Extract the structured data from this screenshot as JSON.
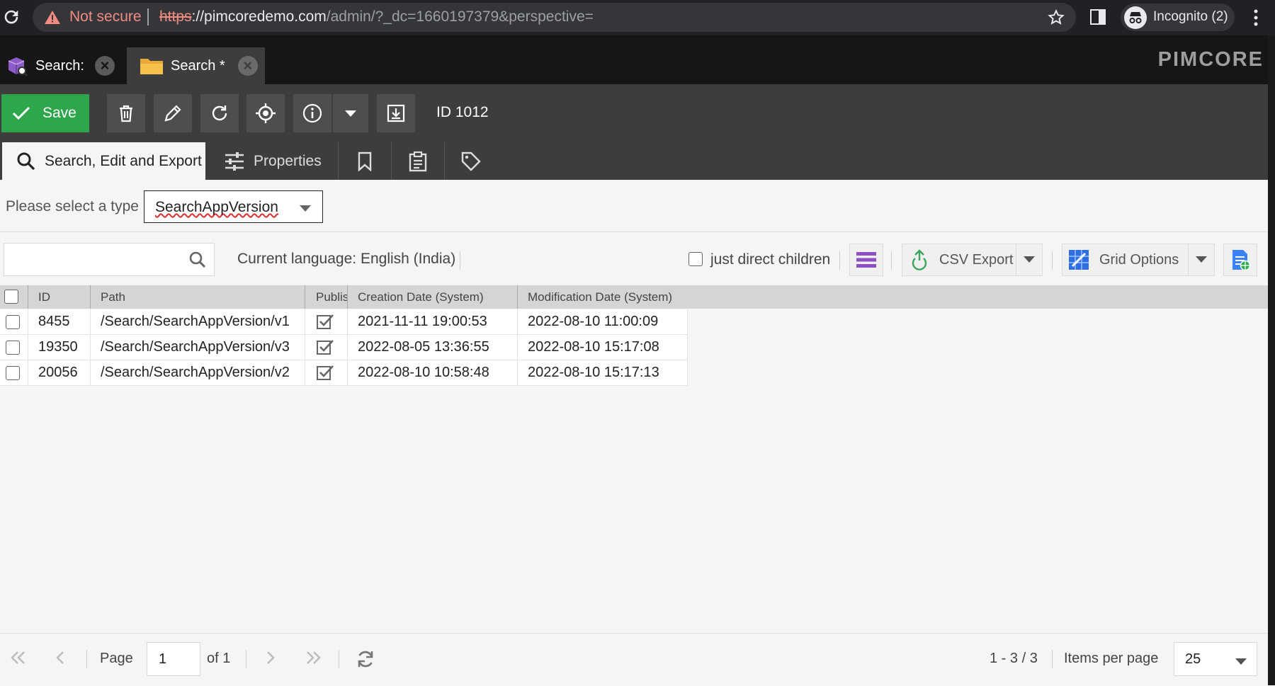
{
  "browser": {
    "not_secure": "Not secure",
    "url_scheme": "https",
    "url_host": "://pimcoredemo.com",
    "url_path": "/admin/?_dc=1660197379&perspective=",
    "incognito": "Incognito (2)"
  },
  "app": {
    "tabs": [
      {
        "label": "Search:"
      },
      {
        "label": "Search *"
      }
    ],
    "brand": "PIMCORE"
  },
  "toolbar": {
    "save_label": "Save",
    "id_label": "ID 1012"
  },
  "subtabs": {
    "search": "Search, Edit and Export",
    "properties": "Properties"
  },
  "type_select": {
    "label": "Please select a type",
    "value": "SearchAppVersion"
  },
  "grid_toolbar": {
    "search_placeholder": "",
    "language": "Current language: English (India)",
    "direct_children": "just direct children",
    "csv_export": "CSV Export",
    "grid_options": "Grid Options"
  },
  "grid": {
    "columns": [
      "ID",
      "Path",
      "Publis",
      "Creation Date (System)",
      "Modification Date (System)"
    ],
    "rows": [
      {
        "id": "8455",
        "path": "/Search/SearchAppVersion/v1",
        "created": "2021-11-11 19:00:53",
        "modified": "2022-08-10 11:00:09"
      },
      {
        "id": "19350",
        "path": "/Search/SearchAppVersion/v3",
        "created": "2022-08-05 13:36:55",
        "modified": "2022-08-10 15:17:08"
      },
      {
        "id": "20056",
        "path": "/Search/SearchAppVersion/v2",
        "created": "2022-08-10 10:58:48",
        "modified": "2022-08-10 15:17:13"
      }
    ]
  },
  "pager": {
    "page_label": "Page",
    "page_value": "1",
    "of_label": "of 1",
    "range": "1 - 3 / 3",
    "items_per_page": "Items per page",
    "per_page_value": "25"
  },
  "colors": {
    "save_green": "#2ea64c",
    "dark_bg": "#3d3d3d",
    "warning_red": "#f28b82"
  }
}
